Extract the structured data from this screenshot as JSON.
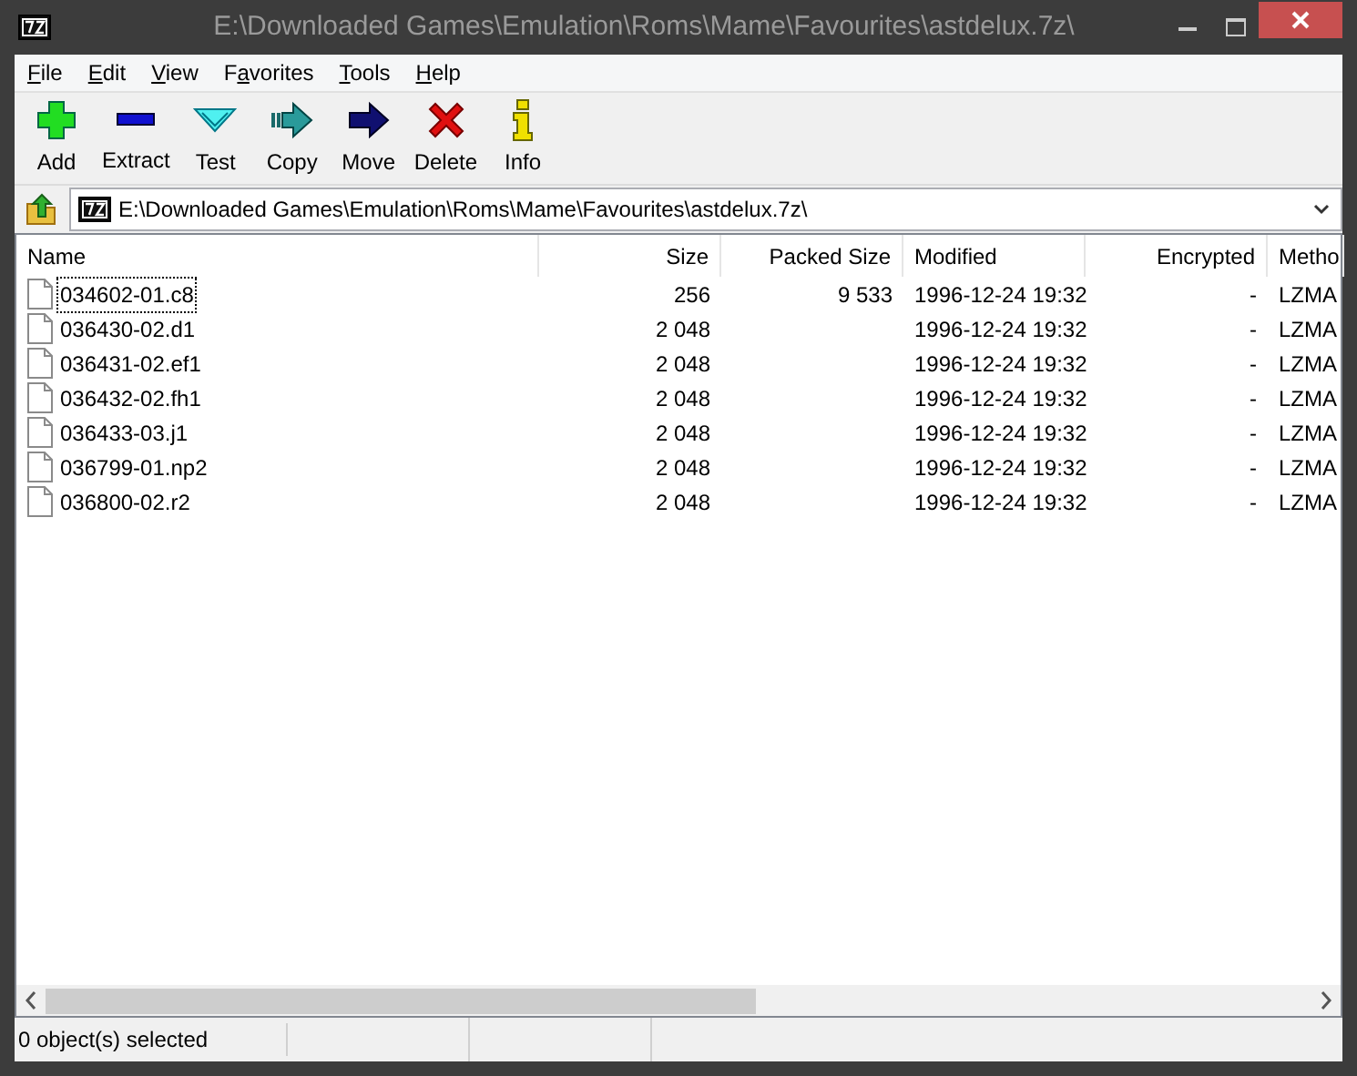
{
  "window": {
    "title": "E:\\Downloaded Games\\Emulation\\Roms\\Mame\\Favourites\\astdelux.7z\\"
  },
  "menu": [
    {
      "accelerator": "F",
      "after": "ile"
    },
    {
      "accelerator": "E",
      "after": "dit"
    },
    {
      "accelerator": "V",
      "after": "iew"
    },
    {
      "before": "F",
      "accelerator": "a",
      "after": "vorites"
    },
    {
      "accelerator": "T",
      "after": "ools"
    },
    {
      "accelerator": "H",
      "after": "elp"
    }
  ],
  "toolbar": [
    {
      "label": "Add",
      "kind": "add"
    },
    {
      "label": "Extract",
      "kind": "extract"
    },
    {
      "label": "Test",
      "kind": "test"
    },
    {
      "label": "Copy",
      "kind": "copy"
    },
    {
      "label": "Move",
      "kind": "move"
    },
    {
      "label": "Delete",
      "kind": "delete"
    },
    {
      "label": "Info",
      "kind": "info"
    }
  ],
  "address": {
    "value": "E:\\Downloaded Games\\Emulation\\Roms\\Mame\\Favourites\\astdelux.7z\\"
  },
  "table": {
    "columns": [
      {
        "label": "Name"
      },
      {
        "label": "Size"
      },
      {
        "label": "Packed Size"
      },
      {
        "label": "Modified"
      },
      {
        "label": "Encrypted"
      },
      {
        "label": "Metho"
      }
    ],
    "rows": [
      {
        "focused": true,
        "cells": [
          "034602-01.c8",
          "256",
          "9 533",
          "1996-12-24 19:32",
          "-",
          "LZMA"
        ]
      },
      {
        "focused": false,
        "cells": [
          "036430-02.d1",
          "2 048",
          "",
          "1996-12-24 19:32",
          "-",
          "LZMA"
        ]
      },
      {
        "focused": false,
        "cells": [
          "036431-02.ef1",
          "2 048",
          "",
          "1996-12-24 19:32",
          "-",
          "LZMA"
        ]
      },
      {
        "focused": false,
        "cells": [
          "036432-02.fh1",
          "2 048",
          "",
          "1996-12-24 19:32",
          "-",
          "LZMA"
        ]
      },
      {
        "focused": false,
        "cells": [
          "036433-03.j1",
          "2 048",
          "",
          "1996-12-24 19:32",
          "-",
          "LZMA"
        ]
      },
      {
        "focused": false,
        "cells": [
          "036799-01.np2",
          "2 048",
          "",
          "1996-12-24 19:32",
          "-",
          "LZMA"
        ]
      },
      {
        "focused": false,
        "cells": [
          "036800-02.r2",
          "2 048",
          "",
          "1996-12-24 19:32",
          "-",
          "LZMA"
        ]
      }
    ]
  },
  "status_bar": [
    "0 object(s) selected"
  ]
}
